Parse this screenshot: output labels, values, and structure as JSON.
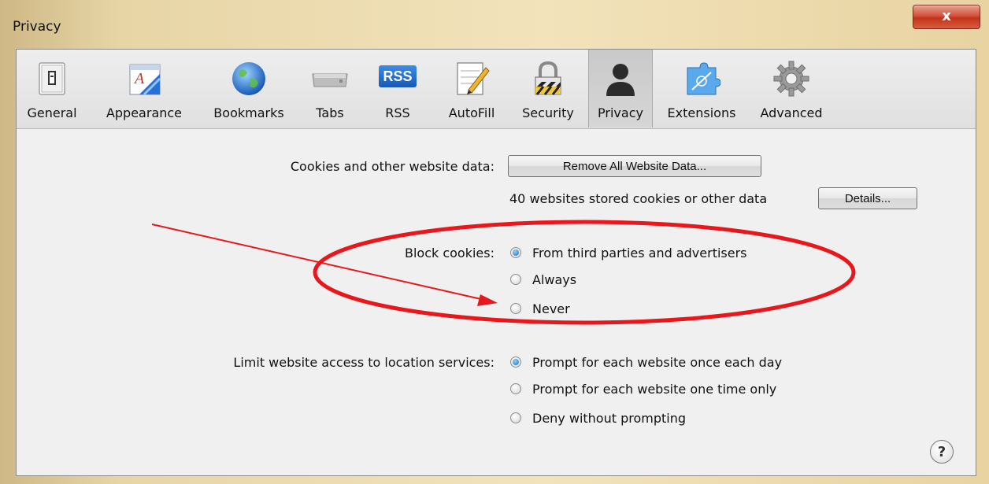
{
  "window": {
    "title": "Privacy",
    "close_label": "x"
  },
  "toolbar": {
    "items": [
      {
        "label": "General",
        "icon": "general-switch-icon"
      },
      {
        "label": "Appearance",
        "icon": "appearance-icon"
      },
      {
        "label": "Bookmarks",
        "icon": "globe-icon"
      },
      {
        "label": "Tabs",
        "icon": "tabs-icon"
      },
      {
        "label": "RSS",
        "icon": "rss-icon"
      },
      {
        "label": "AutoFill",
        "icon": "autofill-icon"
      },
      {
        "label": "Security",
        "icon": "lock-icon"
      },
      {
        "label": "Privacy",
        "icon": "person-silhouette-icon"
      },
      {
        "label": "Extensions",
        "icon": "extensions-icon"
      },
      {
        "label": "Advanced",
        "icon": "gear-icon"
      }
    ],
    "selected": "Privacy",
    "rss_badge": "RSS"
  },
  "cookies": {
    "label": "Cookies and other website data:",
    "remove_button": "Remove All Website Data...",
    "stored_text": "40 websites stored cookies or other data",
    "details_button": "Details..."
  },
  "block_cookies": {
    "label": "Block cookies:",
    "options": [
      "From third parties and advertisers",
      "Always",
      "Never"
    ],
    "selected": "From third parties and advertisers"
  },
  "location": {
    "label": "Limit website access to location services:",
    "options": [
      "Prompt for each website once each day",
      "Prompt for each website one time only",
      "Deny without prompting"
    ],
    "selected": "Prompt for each website once each day"
  },
  "help": {
    "label": "?"
  },
  "annotation": {
    "color": "#e8171b"
  }
}
